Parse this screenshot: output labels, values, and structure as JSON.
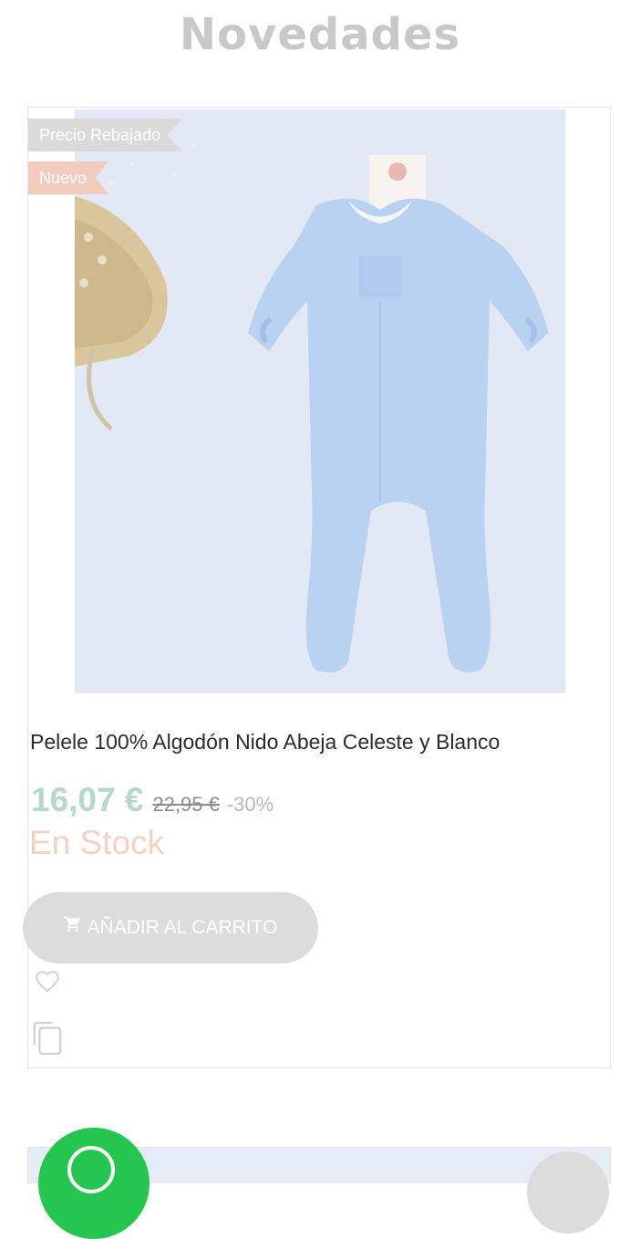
{
  "section": {
    "title": "Novedades"
  },
  "product": {
    "badges": {
      "sale": "Precio Rebajado",
      "new": "Nuevo"
    },
    "name": "Pelele 100% Algodón Nido Abeja Celeste y Blanco",
    "price_current": "16,07 €",
    "price_old": "22,95 €",
    "discount": "-30%",
    "stock": "En Stock",
    "add_to_cart": "AÑADIR AL CARRITO"
  },
  "icons": {
    "cart": "cart-icon",
    "wishlist": "heart-outline-icon",
    "compare": "copy-icon",
    "whatsapp": "whatsapp-icon"
  },
  "colors": {
    "title": "#c8c8c8",
    "price": "#b7d8c6",
    "stock": "#f3d2c4",
    "badge_new": "#f2cdbd",
    "button": "#dcdcdc",
    "whatsapp": "#25c54f"
  }
}
